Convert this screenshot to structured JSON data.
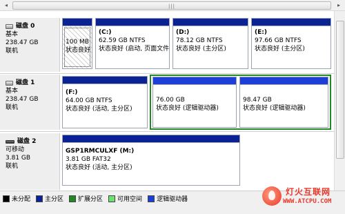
{
  "scrollbar": {
    "left_arrow": "◂",
    "grip": "|||",
    "right_arrow": "▸"
  },
  "disks": [
    {
      "title": "磁盘 0",
      "type": "基本",
      "size": "238.47 GB",
      "status": "联机",
      "partitions": [
        {
          "name": "",
          "size": "100 MB",
          "status": "状态良好",
          "bar": "primary"
        },
        {
          "name": "(C:)",
          "size": "62.59 GB NTFS",
          "status": "状态良好 (启动, 页面文件",
          "bar": "primary"
        },
        {
          "name": "(D:)",
          "size": "78.12 GB NTFS",
          "status": "状态良好 (主分区)",
          "bar": "primary"
        },
        {
          "name": "(E:)",
          "size": "97.66 GB NTFS",
          "status": "状态良好 (主分区)",
          "bar": "primary"
        }
      ]
    },
    {
      "title": "磁盘 1",
      "type": "基本",
      "size": "238.47 GB",
      "status": "联机",
      "partitions": [
        {
          "name": "(F:)",
          "size": "64.00 GB NTFS",
          "status": "状态良好 (活动, 主分区)",
          "bar": "primary"
        },
        {
          "name": "",
          "size": "76.00 GB",
          "status": "状态良好 (逻辑驱动器)",
          "bar": "logical"
        },
        {
          "name": "",
          "size": "98.47 GB",
          "status": "状态良好 (逻辑驱动器)",
          "bar": "logical"
        }
      ]
    },
    {
      "title": "磁盘 2",
      "type": "可移动",
      "size": "3.81 GB",
      "status": "联机",
      "partitions": [
        {
          "name": "GSP1RMCULXF  (M:)",
          "size": "3.81 GB FAT32",
          "status": "状态良好 (活动, 主分区)",
          "bar": "primary"
        }
      ]
    }
  ],
  "legend": [
    {
      "label": "未分配",
      "color": "#000000"
    },
    {
      "label": "主分区",
      "color": "#0a2293"
    },
    {
      "label": "扩展分区",
      "color": "#1f8a25"
    },
    {
      "label": "可用空间",
      "color": "#6fe06f"
    },
    {
      "label": "逻辑驱动器",
      "color": "#1d3fd8"
    }
  ],
  "colors": {
    "primary": "#0a2293",
    "logical": "#1d3fd8",
    "extended": "#1f8a25"
  },
  "watermark": {
    "name": "灯火互联网",
    "url": "WWW.ATCPU.COM"
  }
}
